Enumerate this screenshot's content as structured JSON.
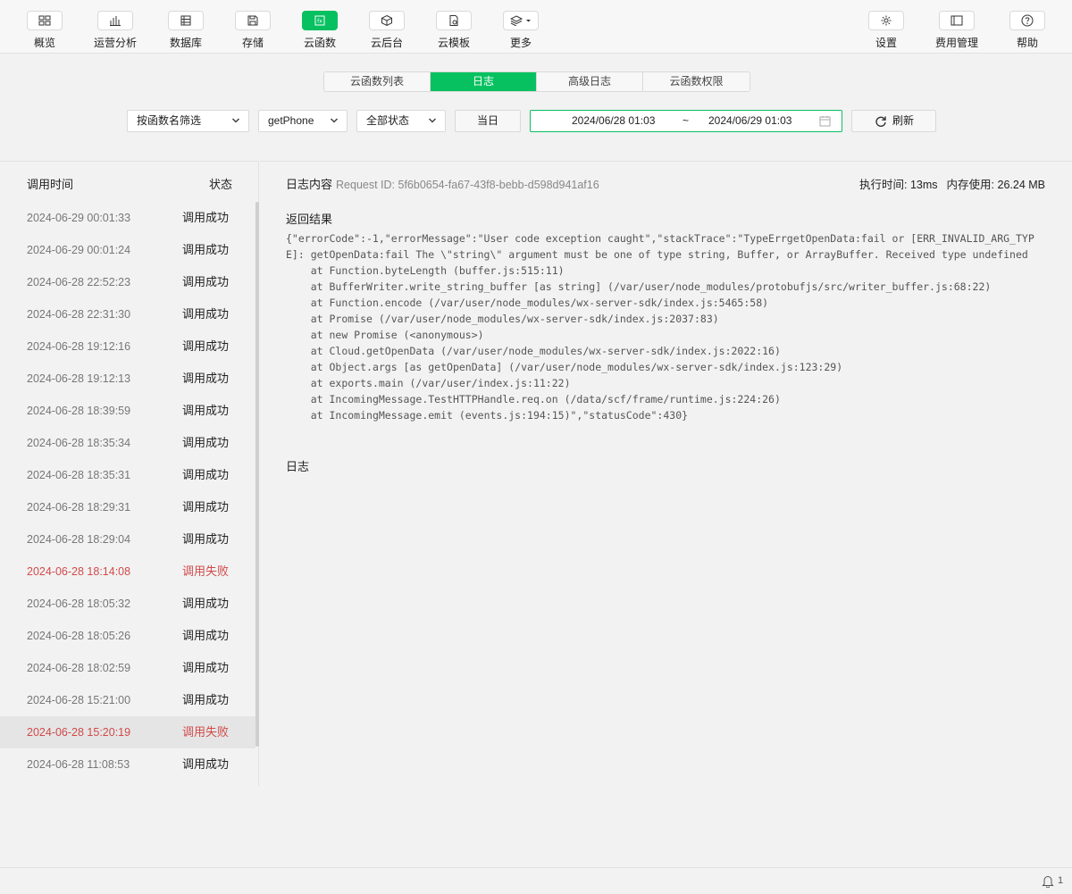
{
  "toolbar": {
    "items": [
      {
        "label": "概览",
        "icon": "overview-icon"
      },
      {
        "label": "运营分析",
        "icon": "chart-icon"
      },
      {
        "label": "数据库",
        "icon": "database-icon"
      },
      {
        "label": "存储",
        "icon": "storage-icon"
      },
      {
        "label": "云函数",
        "icon": "function-icon",
        "active": true
      },
      {
        "label": "云后台",
        "icon": "cube-icon"
      },
      {
        "label": "云模板",
        "icon": "template-icon"
      },
      {
        "label": "更多",
        "icon": "layers-icon"
      },
      {
        "label": "设置",
        "icon": "gear-icon"
      },
      {
        "label": "费用管理",
        "icon": "billing-icon"
      },
      {
        "label": "帮助",
        "icon": "help-icon"
      }
    ]
  },
  "tabs": [
    "云函数列表",
    "日志",
    "高级日志",
    "云函数权限"
  ],
  "active_tab": 1,
  "filters": {
    "filter_mode": "按函数名筛选",
    "function": "getPhone",
    "status": "全部状态",
    "today_label": "当日",
    "date_start": "2024/06/28 01:03",
    "date_sep": "~",
    "date_end": "2024/06/29 01:03",
    "refresh_label": "刷新"
  },
  "list": {
    "col_time": "调用时间",
    "col_status": "状态",
    "rows": [
      {
        "time": "2024-06-29 00:01:33",
        "status": "调用成功"
      },
      {
        "time": "2024-06-29 00:01:24",
        "status": "调用成功"
      },
      {
        "time": "2024-06-28 22:52:23",
        "status": "调用成功"
      },
      {
        "time": "2024-06-28 22:31:30",
        "status": "调用成功"
      },
      {
        "time": "2024-06-28 19:12:16",
        "status": "调用成功"
      },
      {
        "time": "2024-06-28 19:12:13",
        "status": "调用成功"
      },
      {
        "time": "2024-06-28 18:39:59",
        "status": "调用成功"
      },
      {
        "time": "2024-06-28 18:35:34",
        "status": "调用成功"
      },
      {
        "time": "2024-06-28 18:35:31",
        "status": "调用成功"
      },
      {
        "time": "2024-06-28 18:29:31",
        "status": "调用成功"
      },
      {
        "time": "2024-06-28 18:29:04",
        "status": "调用成功"
      },
      {
        "time": "2024-06-28 18:14:08",
        "status": "调用失败",
        "failed": true
      },
      {
        "time": "2024-06-28 18:05:32",
        "status": "调用成功"
      },
      {
        "time": "2024-06-28 18:05:26",
        "status": "调用成功"
      },
      {
        "time": "2024-06-28 18:02:59",
        "status": "调用成功"
      },
      {
        "time": "2024-06-28 15:21:00",
        "status": "调用成功"
      },
      {
        "time": "2024-06-28 15:20:19",
        "status": "调用失败",
        "failed": true,
        "selected": true
      },
      {
        "time": "2024-06-28 11:08:53",
        "status": "调用成功"
      }
    ]
  },
  "detail": {
    "title": "日志内容",
    "request_id": "Request ID: 5f6b0654-fa67-43f8-bebb-d598d941af16",
    "exec_time": "执行时间: 13ms",
    "memory": "内存使用: 26.24 MB",
    "result_title": "返回结果",
    "result_text": "{\"errorCode\":-1,\"errorMessage\":\"User code exception caught\",\"stackTrace\":\"TypeErrgetOpenData:fail or [ERR_INVALID_ARG_TYPE]: getOpenData:fail The \\\"string\\\" argument must be one of type string, Buffer, or ArrayBuffer. Received type undefined\n    at Function.byteLength (buffer.js:515:11)\n    at BufferWriter.write_string_buffer [as string] (/var/user/node_modules/protobufjs/src/writer_buffer.js:68:22)\n    at Function.encode (/var/user/node_modules/wx-server-sdk/index.js:5465:58)\n    at Promise (/var/user/node_modules/wx-server-sdk/index.js:2037:83)\n    at new Promise (<anonymous>)\n    at Cloud.getOpenData (/var/user/node_modules/wx-server-sdk/index.js:2022:16)\n    at Object.args [as getOpenData] (/var/user/node_modules/wx-server-sdk/index.js:123:29)\n    at exports.main (/var/user/index.js:11:22)\n    at IncomingMessage.TestHTTPHandle.req.on (/data/scf/frame/runtime.js:224:26)\n    at IncomingMessage.emit (events.js:194:15)\",\"statusCode\":430}",
    "log_title": "日志"
  },
  "notifications": {
    "count": "1"
  },
  "colors": {
    "accent": "#07c160",
    "fail": "#d14a4a"
  }
}
